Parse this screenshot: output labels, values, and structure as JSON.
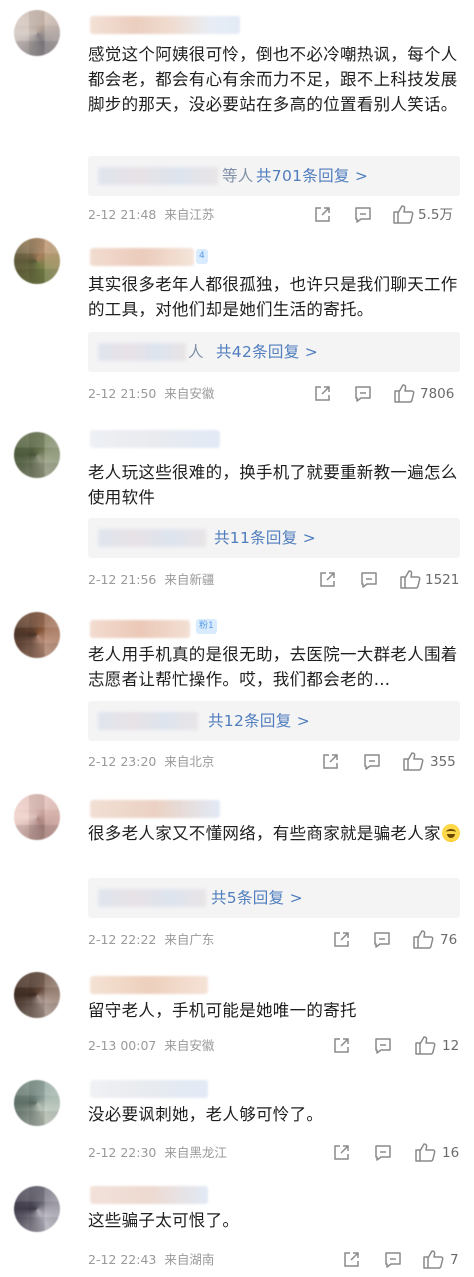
{
  "comments": [
    {
      "text": "感觉这个阿姨很可怜，倒也不必冷嘲热讽，每个人都会老，都会有心有余而力不足，跟不上科技发展脚步的那天，没必要站在多高的位置看别人笑话。",
      "reply_prefix": "等人",
      "reply_label": "共701条回复 >",
      "time": "2-12 21:48",
      "location": "来自江苏",
      "likes": "5.5万",
      "avatar_colors": [
        "#c9b4a7",
        "#8f8a8f",
        "#d9cfc9"
      ]
    },
    {
      "text": "其实很多老年人都很孤独，也许只是我们聊天工作的工具，对他们却是她们生活的寄托。",
      "badge": "4",
      "reply_prefix": "人",
      "reply_label": "共42条回复 >",
      "time": "2-12 21:50",
      "location": "来自安徽",
      "likes": "7806",
      "avatar_colors": [
        "#b78a63",
        "#7f8a4c",
        "#5e5a3a"
      ]
    },
    {
      "text": "老人玩这些很难的，换手机了就要重新教一遍怎么使用软件",
      "reply_prefix": "",
      "reply_label": "共11条回复 >",
      "time": "2-12 21:56",
      "location": "来自新疆",
      "likes": "1521",
      "avatar_colors": [
        "#6f7c55",
        "#a3a98e",
        "#4d5a3c"
      ]
    },
    {
      "text": "老人用手机真的是很无助，去医院一大群老人围着志愿者让帮忙操作。哎，我们都会老的…",
      "badge": "粉1",
      "reply_prefix": "",
      "reply_label": "共12条回复 >",
      "time": "2-12 23:20",
      "location": "来自北京",
      "likes": "355",
      "avatar_colors": [
        "#8e5a3c",
        "#c49680",
        "#4b3428"
      ]
    },
    {
      "text": "很多老人家又不懂网络，有些商家就是骗老人家",
      "has_emoji": true,
      "reply_prefix": "",
      "reply_label": "共5条回复 >",
      "time": "2-12 22:22",
      "location": "来自广东",
      "likes": "76",
      "avatar_colors": [
        "#e0b7b0",
        "#b98f8a",
        "#f1d6d0"
      ]
    },
    {
      "text": "留守老人，手机可能是她唯一的寄托",
      "time": "2-13 00:07",
      "location": "来自安徽",
      "likes": "12",
      "avatar_colors": [
        "#6b4e3e",
        "#b8a49a",
        "#3e2c22"
      ]
    },
    {
      "text": "没必要讽刺她，老人够可怜了。",
      "time": "2-12 22:30",
      "location": "来自黑龙江",
      "likes": "16",
      "avatar_colors": [
        "#8ca29a",
        "#c9d2c5",
        "#5e6f67"
      ]
    },
    {
      "text": "这些骗子太可恨了。",
      "time": "2-12 22:43",
      "location": "来自湖南",
      "likes": "7",
      "avatar_colors": [
        "#6d6a78",
        "#c6c3cf",
        "#403c4a"
      ]
    }
  ],
  "icons": {
    "share": "share-icon",
    "comment": "comment-icon",
    "like": "thumbs-up-icon"
  }
}
